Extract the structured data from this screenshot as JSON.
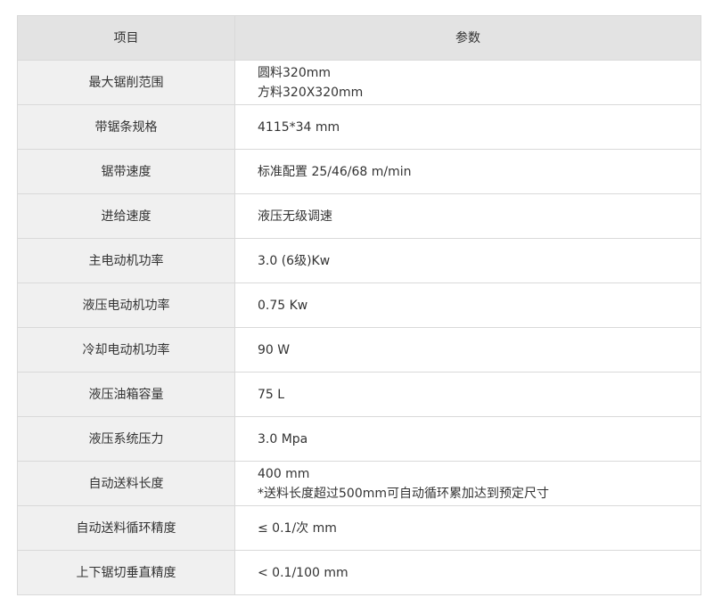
{
  "header": {
    "item_label": "项目",
    "param_label": "参数"
  },
  "rows": [
    {
      "item": "最大锯削范围",
      "lines": [
        "圆料320mm",
        "方料320X320mm"
      ]
    },
    {
      "item": "带锯条规格",
      "lines": [
        "4115*34 mm"
      ]
    },
    {
      "item": "锯带速度",
      "lines": [
        "标准配置 25/46/68 m/min"
      ]
    },
    {
      "item": "进给速度",
      "lines": [
        "液压无级调速"
      ]
    },
    {
      "item": "主电动机功率",
      "lines": [
        "3.0 (6级)Kw"
      ]
    },
    {
      "item": "液压电动机功率",
      "lines": [
        "0.75 Kw"
      ]
    },
    {
      "item": "冷却电动机功率",
      "lines": [
        "90 W"
      ]
    },
    {
      "item": "液压油箱容量",
      "lines": [
        "75 L"
      ]
    },
    {
      "item": "液压系统压力",
      "lines": [
        "3.0 Mpa"
      ]
    },
    {
      "item": "自动送料长度",
      "lines": [
        "400 mm",
        "*送料长度超过500mm可自动循环累加达到预定尺寸"
      ]
    },
    {
      "item": "自动送料循环精度",
      "lines": [
        "≤ 0.1/次 mm"
      ]
    },
    {
      "item": "上下锯切垂直精度",
      "lines": [
        "< 0.1/100 mm"
      ]
    }
  ]
}
